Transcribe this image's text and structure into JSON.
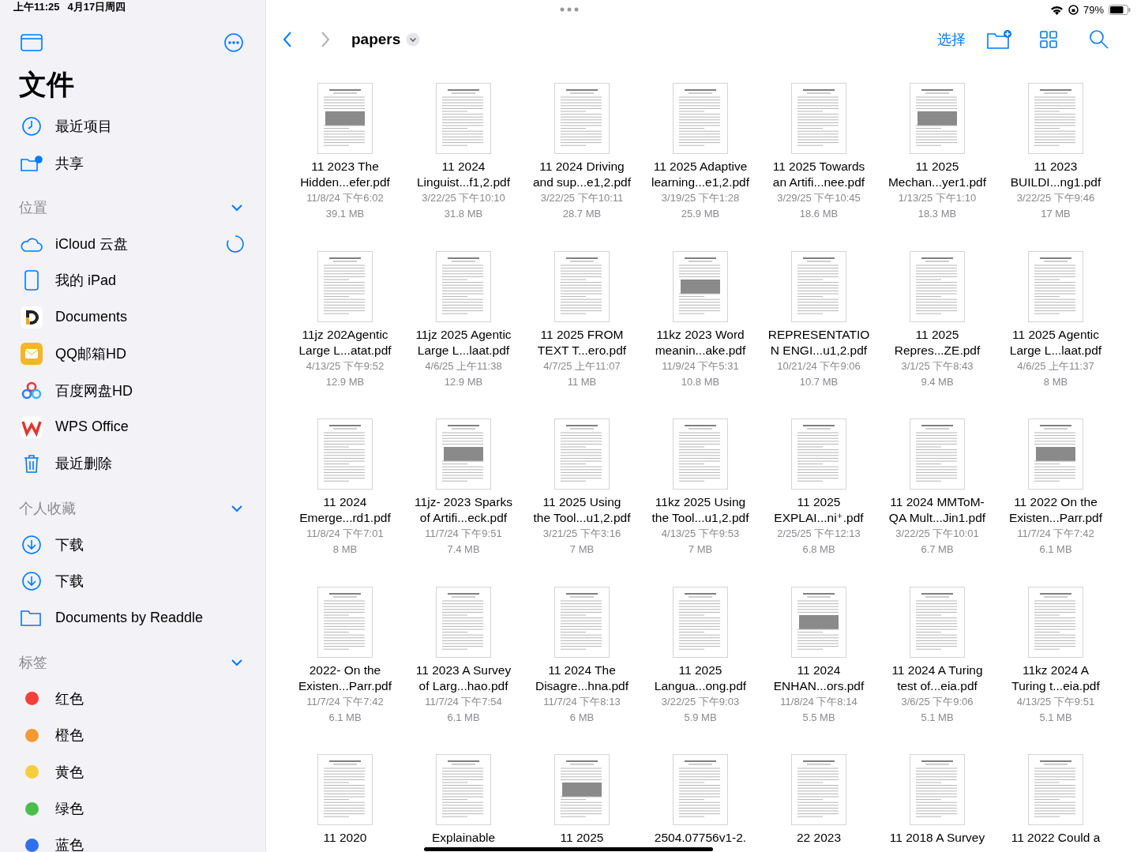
{
  "status_bar": {
    "time": "上午11:25",
    "date": "4月17日周四",
    "battery": "79%"
  },
  "sidebar": {
    "title": "文件",
    "top_items": [
      {
        "label": "最近项目",
        "kind": "clock"
      },
      {
        "label": "共享",
        "kind": "shared"
      }
    ],
    "sections": [
      {
        "title": "位置",
        "expanded": true,
        "items": [
          {
            "label": "iCloud 云盘",
            "kind": "icloud",
            "syncing": true
          },
          {
            "label": "我的 iPad",
            "kind": "ipad"
          },
          {
            "label": "Documents",
            "kind": "documents"
          },
          {
            "label": "QQ邮箱HD",
            "kind": "mail"
          },
          {
            "label": "百度网盘HD",
            "kind": "baidu"
          },
          {
            "label": "WPS Office",
            "kind": "wps"
          },
          {
            "label": "最近删除",
            "kind": "trash"
          }
        ]
      },
      {
        "title": "个人收藏",
        "expanded": true,
        "items": [
          {
            "label": "下载",
            "kind": "download"
          },
          {
            "label": "下载",
            "kind": "download"
          },
          {
            "label": "Documents by Readdle",
            "kind": "folder"
          }
        ]
      },
      {
        "title": "标签",
        "expanded": true,
        "items": [
          {
            "label": "红色",
            "kind": "tag",
            "color": "#f2413a"
          },
          {
            "label": "橙色",
            "kind": "tag",
            "color": "#f59a33"
          },
          {
            "label": "黄色",
            "kind": "tag",
            "color": "#f7cd3c"
          },
          {
            "label": "绿色",
            "kind": "tag",
            "color": "#4cbc4d"
          },
          {
            "label": "蓝色",
            "kind": "tag",
            "color": "#2f6ff0"
          }
        ]
      }
    ]
  },
  "toolbar": {
    "folder": "papers",
    "select": "选择"
  },
  "files": [
    {
      "lines": [
        "11 2023 The",
        "Hidden...efer.pdf"
      ],
      "date": "11/8/24 下午6:02",
      "size": "39.1 MB"
    },
    {
      "lines": [
        "11 2024",
        "Linguist...f1,2.pdf"
      ],
      "date": "3/22/25 下午10:10",
      "size": "31.8 MB"
    },
    {
      "lines": [
        "11 2024 Driving",
        "and sup...e1,2.pdf"
      ],
      "date": "3/22/25 下午10:11",
      "size": "28.7 MB"
    },
    {
      "lines": [
        "11 2025 Adaptive",
        "learning...e1,2.pdf"
      ],
      "date": "3/19/25 下午1:28",
      "size": "25.9 MB"
    },
    {
      "lines": [
        "11 2025 Towards",
        "an Artifi...nee.pdf"
      ],
      "date": "3/29/25 下午10:45",
      "size": "18.6 MB"
    },
    {
      "lines": [
        "11 2025",
        "Mechan...yer1.pdf"
      ],
      "date": "1/13/25 下午1:10",
      "size": "18.3 MB"
    },
    {
      "lines": [
        "11 2023",
        "BUILDI...ng1.pdf"
      ],
      "date": "3/22/25 下午9:46",
      "size": "17 MB"
    },
    {
      "lines": [
        "11jz 202Agentic",
        "Large L...atat.pdf"
      ],
      "date": "4/13/25 下午9:52",
      "size": "12.9 MB"
    },
    {
      "lines": [
        "11jz 2025 Agentic",
        "Large L...laat.pdf"
      ],
      "date": "4/6/25 上午11:38",
      "size": "12.9 MB"
    },
    {
      "lines": [
        "11 2025 FROM",
        "TEXT T...ero.pdf"
      ],
      "date": "4/7/25 上午11:07",
      "size": "11 MB"
    },
    {
      "lines": [
        "11kz 2023 Word",
        "meanin...ake.pdf"
      ],
      "date": "11/9/24 下午5:31",
      "size": "10.8 MB"
    },
    {
      "lines": [
        "REPRESENTATIO",
        "N ENGI...u1,2.pdf"
      ],
      "date": "10/21/24 下午9:06",
      "size": "10.7 MB"
    },
    {
      "lines": [
        "11 2025",
        "Repres...ZE.pdf"
      ],
      "date": "3/1/25 下午8:43",
      "size": "9.4 MB"
    },
    {
      "lines": [
        "11 2025 Agentic",
        "Large L...laat.pdf"
      ],
      "date": "4/6/25 上午11:37",
      "size": "8 MB"
    },
    {
      "lines": [
        "11 2024",
        "Emerge...rd1.pdf"
      ],
      "date": "11/8/24 下午7:01",
      "size": "8 MB"
    },
    {
      "lines": [
        "11jz- 2023 Sparks",
        "of Artifi...eck.pdf"
      ],
      "date": "11/7/24 下午9:51",
      "size": "7.4 MB"
    },
    {
      "lines": [
        "11 2025 Using",
        "the Tool...u1,2.pdf"
      ],
      "date": "3/21/25 下午3:16",
      "size": "7 MB"
    },
    {
      "lines": [
        "11kz 2025 Using",
        "the Tool...u1,2.pdf"
      ],
      "date": "4/13/25 下午9:53",
      "size": "7 MB"
    },
    {
      "lines": [
        "11 2025",
        "EXPLAI...ni⁺.pdf"
      ],
      "date": "2/25/25 下午12:13",
      "size": "6.8 MB"
    },
    {
      "lines": [
        "11 2024 MMToM-",
        "QA Mult...Jin1.pdf"
      ],
      "date": "3/22/25 下午10:01",
      "size": "6.7 MB"
    },
    {
      "lines": [
        "11 2022 On the",
        "Existen...Parr.pdf"
      ],
      "date": "11/7/24 下午7:42",
      "size": "6.1 MB"
    },
    {
      "lines": [
        "2022- On the",
        "Existen...Parr.pdf"
      ],
      "date": "11/7/24 下午7:42",
      "size": "6.1 MB"
    },
    {
      "lines": [
        "11 2023 A Survey",
        "of Larg...hao.pdf"
      ],
      "date": "11/7/24 下午7:54",
      "size": "6.1 MB"
    },
    {
      "lines": [
        "11 2024 The",
        "Disagre...hna.pdf"
      ],
      "date": "11/7/24 下午8:13",
      "size": "6 MB"
    },
    {
      "lines": [
        "11 2025",
        "Langua...ong.pdf"
      ],
      "date": "3/22/25 下午9:03",
      "size": "5.9 MB"
    },
    {
      "lines": [
        "11 2024",
        "ENHAN...ors.pdf"
      ],
      "date": "11/8/24 下午8:14",
      "size": "5.5 MB"
    },
    {
      "lines": [
        "11 2024 A Turing",
        "test of...eia.pdf"
      ],
      "date": "3/6/25 下午9:06",
      "size": "5.1 MB"
    },
    {
      "lines": [
        "11kz 2024 A",
        "Turing t...eia.pdf"
      ],
      "date": "4/13/25 下午9:51",
      "size": "5.1 MB"
    },
    {
      "lines": [
        "11 2020"
      ]
    },
    {
      "lines": [
        "Explainable"
      ]
    },
    {
      "lines": [
        "11 2025"
      ]
    },
    {
      "lines": [
        "2504.07756v1-2."
      ]
    },
    {
      "lines": [
        "22 2023"
      ]
    },
    {
      "lines": [
        "11 2018 A Survey"
      ]
    },
    {
      "lines": [
        "11 2022 Could a"
      ]
    }
  ]
}
